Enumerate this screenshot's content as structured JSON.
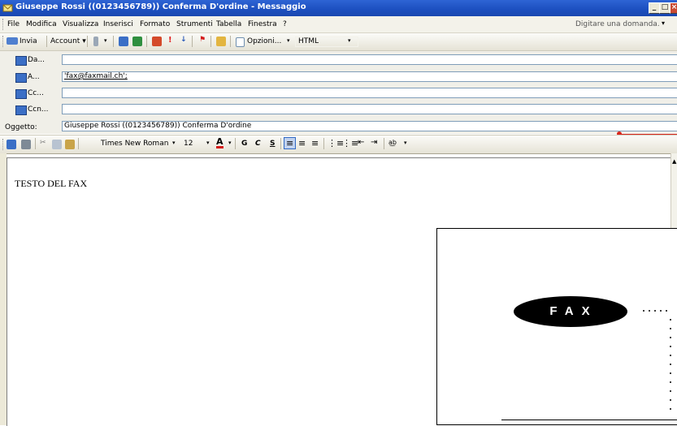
{
  "window": {
    "title": "Giuseppe Rossi ((0123456789)) Conferma D'ordine - Messaggio",
    "min_btn": "_",
    "max_btn": "□",
    "close_btn": "×"
  },
  "menu": {
    "items": [
      "File",
      "Modifica",
      "Visualizza",
      "Inserisci",
      "Formato",
      "Strumenti",
      "Tabella",
      "Finestra",
      "?"
    ],
    "ask_placeholder": "Digitare una domanda.",
    "ask_arrow": "▾"
  },
  "toolbar": {
    "send_label": "Invia",
    "account_label": "Account ▾",
    "options_label": "Opzioni...",
    "options_arrow": "▾",
    "format_value": "HTML",
    "format_arrow": "▾"
  },
  "header": {
    "from_label": "Da...",
    "from_value": "",
    "to_label": "A...",
    "to_value": "'fax@faxmail.ch';",
    "cc_label": "Cc...",
    "cc_value": "",
    "bcc_label": "Ccn...",
    "bcc_value": "",
    "subject_label": "Oggetto:",
    "subject_value": "Giuseppe Rossi ((0123456789)) Conferma D'ordine"
  },
  "formatbar": {
    "font": "Times New Roman",
    "font_arrow": "▾",
    "size": "12",
    "size_arrow": "▾",
    "font_color_label": "A",
    "bold": "G",
    "italic": "C",
    "underline": "S"
  },
  "body": {
    "text": "TESTO DEL FAX",
    "fax_logo": "FAX"
  },
  "colors": {
    "title_blue": "#1c4fbf",
    "annotation_red": "#d9261c"
  }
}
